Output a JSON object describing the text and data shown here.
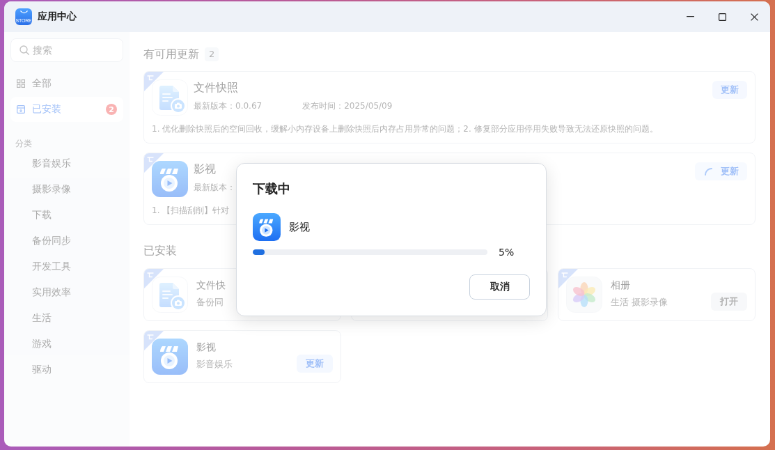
{
  "window": {
    "title": "应用中心",
    "logo_text": "STORE"
  },
  "sidebar": {
    "search": {
      "placeholder": "搜索"
    },
    "nav": [
      {
        "label": "全部",
        "selected": false
      },
      {
        "label": "已安装",
        "selected": true,
        "badge": "2"
      }
    ],
    "section_label": "分类",
    "categories": [
      "影音娱乐",
      "摄影录像",
      "下载",
      "备份同步",
      "开发工具",
      "实用效率",
      "生活",
      "游戏",
      "驱动"
    ]
  },
  "updates": {
    "heading": "有可用更新",
    "count": "2",
    "items": [
      {
        "kind": "document",
        "name": "文件快照",
        "meta": [
          "最新版本：0.0.67",
          "发布时间：2025/05/09"
        ],
        "notes": "1. 优化删除快照后的空间回收，缓解小内存设备上删除快照后内存占用异常的问题；2. 修复部分应用停用失败导致无法还原快照的问题。",
        "button": {
          "label": "更新",
          "loading": false
        }
      },
      {
        "kind": "video",
        "name": "影视",
        "meta": [
          "最新版本："
        ],
        "notes": "1. 【扫描刮削】针对",
        "button": {
          "label": "更新",
          "loading": true
        }
      }
    ]
  },
  "installed": {
    "heading": "已安装",
    "items": [
      {
        "kind": "document",
        "name": "文件快",
        "category": "备份同"
      },
      {
        "kind": "covered"
      },
      {
        "kind": "photos",
        "name": "相册",
        "category": "生活 摄影录像",
        "button": {
          "kind": "open",
          "label": "打开"
        }
      },
      {
        "kind": "video",
        "name": "影视",
        "category": "影音娱乐",
        "button": {
          "kind": "update",
          "label": "更新"
        }
      }
    ]
  },
  "dialog": {
    "title": "下载中",
    "app": {
      "kind": "video",
      "name": "影视"
    },
    "level": 0.05,
    "percent": "5%",
    "button": "取消"
  }
}
